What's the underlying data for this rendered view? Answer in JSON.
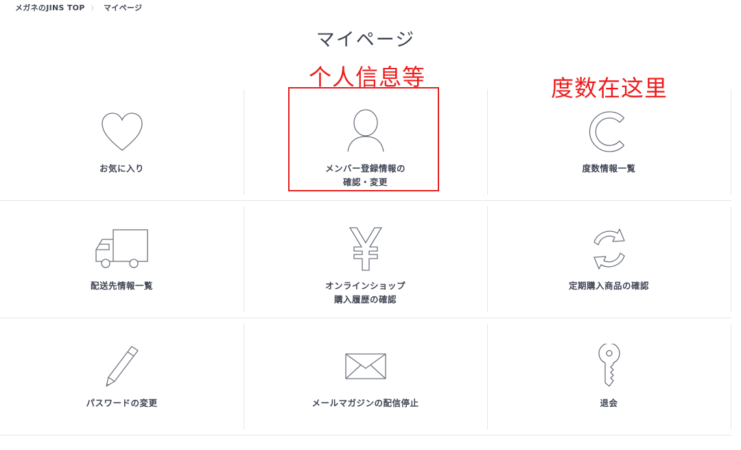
{
  "breadcrumb": {
    "home": "メガネのJINS TOP",
    "separator": "〉",
    "current": "マイページ"
  },
  "page": {
    "title": "マイページ"
  },
  "annotations": {
    "personal_info": "个人信息等",
    "degree_here": "度数在这里"
  },
  "menu": [
    {
      "label_line1": "お気に入り",
      "label_line2": "",
      "icon": "heart-icon"
    },
    {
      "label_line1": "メンバー登録情報の",
      "label_line2": "確認・変更",
      "icon": "person-icon"
    },
    {
      "label_line1": "度数情報一覧",
      "label_line2": "",
      "icon": "lens-c-icon"
    },
    {
      "label_line1": "配送先情報一覧",
      "label_line2": "",
      "icon": "truck-icon"
    },
    {
      "label_line1": "オンラインショップ",
      "label_line2": "購入履歴の確認",
      "icon": "yen-icon"
    },
    {
      "label_line1": "定期購入商品の確認",
      "label_line2": "",
      "icon": "refresh-icon"
    },
    {
      "label_line1": "パスワードの変更",
      "label_line2": "",
      "icon": "pencil-icon"
    },
    {
      "label_line1": "メールマガジンの配信停止",
      "label_line2": "",
      "icon": "envelope-icon"
    },
    {
      "label_line1": "退会",
      "label_line2": "",
      "icon": "key-icon"
    }
  ],
  "colors": {
    "text": "#3f4554",
    "annotation": "#ee1c1c",
    "divider": "#e3e5e9",
    "icon_stroke": "#6b717d"
  }
}
